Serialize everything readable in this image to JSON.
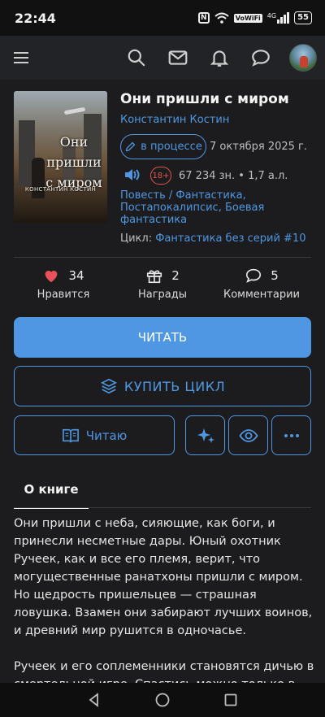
{
  "status_bar": {
    "time": "22:44",
    "nfc": "N",
    "wifi_label": "VoWiFi",
    "signal": "4G",
    "battery": "55"
  },
  "app_bar": {
    "icons": [
      "menu-icon",
      "search-icon",
      "mail-icon",
      "bell-icon",
      "chat-icon",
      "avatar"
    ]
  },
  "book": {
    "cover_title": "Они пришли с миром",
    "cover_author": "КОНСТАНТИН КОСТИН",
    "title": "Они пришли с миром",
    "author": "Константин Костин",
    "status": "в процессе",
    "date": "7 октября 2025 г.",
    "age_rating": "18+",
    "chars": "67 234 зн. • 1,7 а.л.",
    "genres": "Повесть / Фантастика, Постапокалипсис, Боевая фантастика",
    "cycle_label": "Цикл:",
    "cycle_name": "Фантастика без серий #10"
  },
  "stats": {
    "likes": {
      "count": "34",
      "label": "Нравится",
      "color": "#e8505b"
    },
    "awards": {
      "count": "2",
      "label": "Награды"
    },
    "comments": {
      "count": "5",
      "label": "Комментарии"
    }
  },
  "actions": {
    "read": "ЧИТАТЬ",
    "buy_cycle": "КУПИТЬ ЦИКЛ",
    "reading": "Читаю",
    "accent_color": "#4f97e2"
  },
  "tabs": {
    "about": "О книге"
  },
  "description": {
    "p1": "Они пришли с неба, сияющие, как боги, и принесли несметные дары. Юный охотник Ручеек, как и все его племя, верит, что могущественные ранатхоны пришли с миром. Но щедрость пришельцев — страшная ловушка. Взамен они забирают лучших воинов, и древний мир рушится в одночасье.",
    "p2": "Ручеек и его соплеменники становятся дичью в смертельной игре. Спастись можно только в"
  }
}
